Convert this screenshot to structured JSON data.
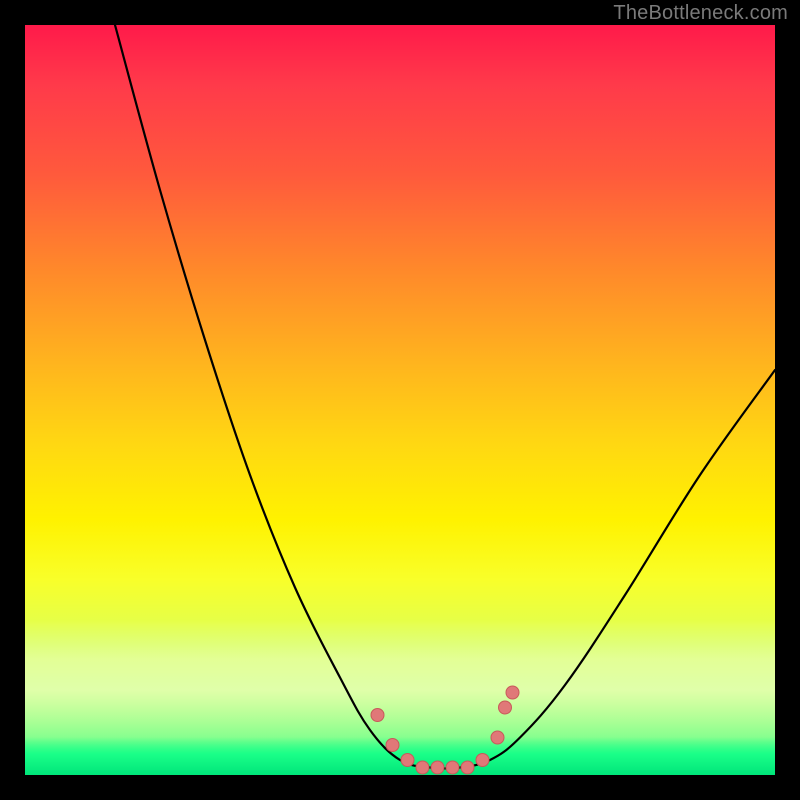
{
  "watermark": "TheBottleneck.com",
  "colors": {
    "frame": "#000000",
    "curve_stroke": "#000000",
    "marker_fill": "#e07878",
    "marker_stroke": "#c85a5a"
  },
  "chart_data": {
    "type": "line",
    "title": "",
    "xlabel": "",
    "ylabel": "",
    "xlim": [
      0,
      100
    ],
    "ylim": [
      0,
      100
    ],
    "grid": false,
    "legend": false,
    "background_gradient": "vertical red→orange→yellow→green",
    "series": [
      {
        "name": "bottleneck-curve",
        "x": [
          12,
          18,
          24,
          30,
          36,
          42,
          46,
          50,
          54,
          58,
          62,
          66,
          72,
          80,
          90,
          100
        ],
        "y": [
          100,
          78,
          58,
          40,
          25,
          13,
          6,
          2,
          1,
          1,
          2,
          5,
          12,
          24,
          40,
          54
        ]
      }
    ],
    "markers": [
      {
        "x": 47,
        "y": 8
      },
      {
        "x": 49,
        "y": 4
      },
      {
        "x": 51,
        "y": 2
      },
      {
        "x": 53,
        "y": 1
      },
      {
        "x": 55,
        "y": 1
      },
      {
        "x": 57,
        "y": 1
      },
      {
        "x": 59,
        "y": 1
      },
      {
        "x": 61,
        "y": 2
      },
      {
        "x": 63,
        "y": 5
      },
      {
        "x": 64,
        "y": 9
      },
      {
        "x": 65,
        "y": 11
      }
    ]
  }
}
